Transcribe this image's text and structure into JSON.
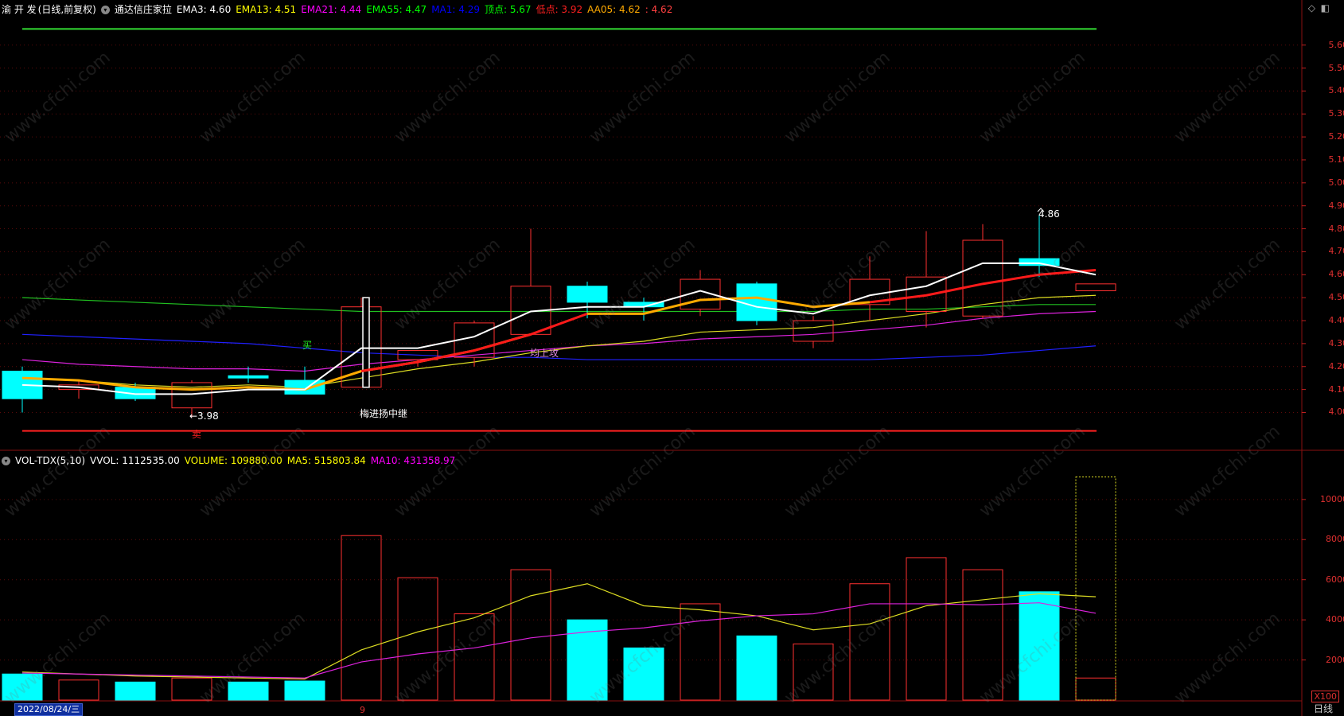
{
  "header": {
    "stock_name": "渝 开 发",
    "mode": "(日线,前复权)",
    "indicator": "通达信庄家拉",
    "items": [
      {
        "label": "EMA3: 4.60",
        "color": "#ffffff"
      },
      {
        "label": "EMA13: 4.51",
        "color": "#ffff00"
      },
      {
        "label": "EMA21: 4.44",
        "color": "#ff00ff"
      },
      {
        "label": "EMA55: 4.47",
        "color": "#00ff00"
      },
      {
        "label": "MA1: 4.29",
        "color": "#0000ff"
      },
      {
        "label": "顶点: 5.67",
        "color": "#00ff00"
      },
      {
        "label": "低点: 3.92",
        "color": "#ff2020"
      },
      {
        "label": "AA05: 4.62",
        "color": "#ffaa00"
      },
      {
        "label": ": 4.62",
        "color": "#ff4040"
      }
    ]
  },
  "vol_header": {
    "title": "VOL-TDX(5,10)",
    "items": [
      {
        "label": "VVOL: 1112535.00",
        "color": "#ffffff"
      },
      {
        "label": "VOLUME: 109880.00",
        "color": "#ffff00"
      },
      {
        "label": "MA5: 515803.84",
        "color": "#ffff00"
      },
      {
        "label": "MA10: 431358.97",
        "color": "#ff00ff"
      }
    ]
  },
  "price_axis": [
    "5.60",
    "5.50",
    "5.40",
    "5.30",
    "5.20",
    "5.10",
    "5.00",
    "4.90",
    "4.80",
    "4.70",
    "4.60",
    "4.50",
    "4.40",
    "4.30",
    "4.20",
    "4.10",
    "4.00"
  ],
  "vol_axis": [
    "10000",
    "8000",
    "6000",
    "4000",
    "2000"
  ],
  "vol_unit": "X100",
  "footer": {
    "date": "2022/08/24/三",
    "period": "日线",
    "marker": "9"
  },
  "annotations": {
    "low_label": "3.98",
    "high_label": "4.86",
    "signal_sell": "卖",
    "signal_buy": "买",
    "text_main": "梅进扬中继",
    "text_mid": "均上攻"
  },
  "watermark": "www.cfchi.com",
  "chart_data": {
    "type": "candlestick",
    "candles": [
      {
        "o": 4.18,
        "h": 4.2,
        "l": 4.0,
        "c": 4.06,
        "up": false
      },
      {
        "o": 4.12,
        "h": 4.14,
        "l": 4.06,
        "c": 4.1,
        "up": true
      },
      {
        "o": 4.11,
        "h": 4.13,
        "l": 4.05,
        "c": 4.06,
        "up": false
      },
      {
        "o": 4.13,
        "h": 4.14,
        "l": 3.98,
        "c": 4.02,
        "up": true
      },
      {
        "o": 4.15,
        "h": 4.2,
        "l": 4.13,
        "c": 4.16,
        "up": false
      },
      {
        "o": 4.14,
        "h": 4.2,
        "l": 4.08,
        "c": 4.08,
        "up": false
      },
      {
        "o": 4.11,
        "h": 4.5,
        "l": 4.11,
        "c": 4.46,
        "up": true
      },
      {
        "o": 4.23,
        "h": 4.27,
        "l": 4.2,
        "c": 4.27,
        "up": true
      },
      {
        "o": 4.24,
        "h": 4.4,
        "l": 4.2,
        "c": 4.39,
        "up": true
      },
      {
        "o": 4.34,
        "h": 4.8,
        "l": 4.34,
        "c": 4.55,
        "up": true
      },
      {
        "o": 4.55,
        "h": 4.57,
        "l": 4.41,
        "c": 4.48,
        "up": false
      },
      {
        "o": 4.48,
        "h": 4.5,
        "l": 4.4,
        "c": 4.46,
        "up": false
      },
      {
        "o": 4.45,
        "h": 4.62,
        "l": 4.42,
        "c": 4.58,
        "up": true
      },
      {
        "o": 4.56,
        "h": 4.57,
        "l": 4.38,
        "c": 4.4,
        "up": false
      },
      {
        "o": 4.31,
        "h": 4.42,
        "l": 4.28,
        "c": 4.4,
        "up": true
      },
      {
        "o": 4.47,
        "h": 4.68,
        "l": 4.4,
        "c": 4.58,
        "up": true
      },
      {
        "o": 4.44,
        "h": 4.79,
        "l": 4.37,
        "c": 4.59,
        "up": true
      },
      {
        "o": 4.42,
        "h": 4.82,
        "l": 4.41,
        "c": 4.75,
        "up": true
      },
      {
        "o": 4.67,
        "h": 4.86,
        "l": 4.59,
        "c": 4.64,
        "up": false
      },
      {
        "o": 4.53,
        "h": 4.56,
        "l": 4.53,
        "c": 4.56,
        "up": true
      }
    ],
    "ema3": [
      4.12,
      4.11,
      4.08,
      4.08,
      4.1,
      4.1,
      4.28,
      4.28,
      4.33,
      4.44,
      4.46,
      4.46,
      4.53,
      4.46,
      4.43,
      4.51,
      4.55,
      4.65,
      4.65,
      4.6
    ],
    "aa05": [
      4.15,
      4.14,
      4.11,
      4.1,
      4.11,
      4.1,
      4.18,
      4.22,
      4.27,
      4.34,
      4.43,
      4.43,
      4.49,
      4.5,
      4.46,
      4.48,
      4.51,
      4.56,
      4.6,
      4.62
    ],
    "ema13": [
      4.15,
      4.14,
      4.12,
      4.11,
      4.12,
      4.11,
      4.15,
      4.19,
      4.22,
      4.26,
      4.29,
      4.31,
      4.35,
      4.36,
      4.37,
      4.4,
      4.43,
      4.47,
      4.5,
      4.51
    ],
    "ema21": [
      4.23,
      4.21,
      4.2,
      4.19,
      4.19,
      4.18,
      4.21,
      4.23,
      4.25,
      4.27,
      4.29,
      4.3,
      4.32,
      4.33,
      4.34,
      4.36,
      4.38,
      4.41,
      4.43,
      4.44
    ],
    "ema55": [
      4.5,
      4.49,
      4.48,
      4.47,
      4.46,
      4.45,
      4.44,
      4.44,
      4.44,
      4.44,
      4.44,
      4.44,
      4.44,
      4.44,
      4.44,
      4.45,
      4.45,
      4.46,
      4.47,
      4.47
    ],
    "ma1": [
      4.34,
      4.33,
      4.32,
      4.31,
      4.3,
      4.28,
      4.26,
      4.25,
      4.24,
      4.24,
      4.23,
      4.23,
      4.23,
      4.23,
      4.23,
      4.23,
      4.24,
      4.25,
      4.27,
      4.29
    ],
    "volume": [
      1300,
      1000,
      900,
      1100,
      900,
      950,
      8200,
      6100,
      4300,
      6500,
      4000,
      2600,
      4800,
      3200,
      2800,
      5800,
      7100,
      6500,
      5400,
      1100
    ],
    "volume_up": [
      false,
      true,
      false,
      true,
      false,
      false,
      true,
      true,
      true,
      true,
      false,
      false,
      true,
      false,
      true,
      true,
      true,
      true,
      false,
      true
    ],
    "vol_ma5": [
      1400,
      1300,
      1200,
      1150,
      1100,
      1050,
      2500,
      3400,
      4100,
      5200,
      5800,
      4700,
      4500,
      4200,
      3500,
      3800,
      4700,
      5000,
      5300,
      5150
    ],
    "vol_ma10": [
      1350,
      1300,
      1250,
      1200,
      1150,
      1100,
      1900,
      2300,
      2600,
      3100,
      3400,
      3600,
      3950,
      4200,
      4300,
      4800,
      4800,
      4750,
      4850,
      4330
    ],
    "vvol_bar": 11125,
    "top_line": 5.67,
    "bottom_line": 3.92,
    "price_range": [
      3.87,
      5.72
    ],
    "vol_range": [
      0,
      11500
    ]
  }
}
